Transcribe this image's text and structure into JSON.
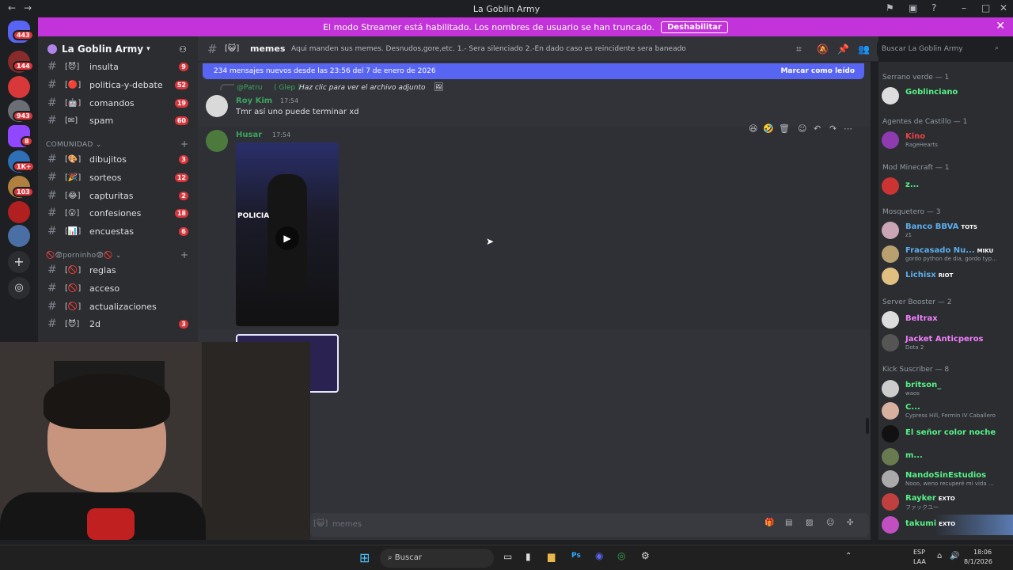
{
  "window": {
    "title": "La Goblin Army"
  },
  "banner": {
    "text": "El modo Streamer está habilitado. Los nombres de usuario se han truncado.",
    "button": "Deshabilitar"
  },
  "servers": {
    "badges": [
      "443",
      "144",
      "943",
      "8",
      "1K+",
      "103"
    ]
  },
  "guild": {
    "name": "La Goblin Army"
  },
  "channels": [
    {
      "name": "insulta",
      "badge": "9"
    },
    {
      "name": "politica-y-debate",
      "badge": "52"
    },
    {
      "name": "comandos",
      "badge": "19"
    },
    {
      "name": "spam",
      "badge": "60"
    }
  ],
  "category_comunidad": "COMUNIDAD",
  "channels2": [
    {
      "name": "dibujitos",
      "badge": "3"
    },
    {
      "name": "sorteos",
      "badge": "12"
    },
    {
      "name": "capturitas",
      "badge": "2"
    },
    {
      "name": "confesiones",
      "badge": "18"
    },
    {
      "name": "encuestas",
      "badge": "6"
    }
  ],
  "category_porninho": "porninho",
  "channels3": [
    {
      "name": "reglas",
      "badge": ""
    },
    {
      "name": "acceso",
      "badge": ""
    },
    {
      "name": "actualizaciones",
      "badge": ""
    },
    {
      "name": "2d",
      "badge": "3"
    }
  ],
  "channel_header": {
    "name": "memes",
    "topic": "Aqui manden sus memes. Desnudos,gore,etc. 1.- Sera silenciado 2.-En dado caso es reincidente sera baneado",
    "search_placeholder": "Buscar La Goblin Army"
  },
  "new_messages": {
    "text": "234 mensajes nuevos desde las 23:56 del 7 de enero de 2026",
    "mark": "Marcar como leído"
  },
  "messages": {
    "reply_user": "@Patru",
    "reply_tag": "( Glep )",
    "reply_text": "Haz clic para ver el archivo adjunto",
    "m1_user": "Roy Kim",
    "m1_time": "17:54",
    "m1_text": "Tmr así uno puede terminar xd",
    "m2_user": "Husar",
    "m2_time": "17:54"
  },
  "video_label": "POLICIA",
  "composer_placeholder": "memes",
  "members": {
    "cat1": "Serrano verde — 1",
    "m1": "Goblinciano",
    "cat2": "Agentes de Castillo — 1",
    "m2": "Kino",
    "m2s": "RageHearts",
    "cat3": "Mod Minecraft — 1",
    "m3": "z...",
    "cat4": "Mosquetero — 3",
    "m4": "Banco BBVA",
    "m4t": "TOTS",
    "m4s": "z1",
    "m5": "Fracasado Nu...",
    "m5t": "MIKU",
    "m5s": "gordo python de dia, gordo typ...",
    "m6": "Lichisx",
    "m6t": "RIOT",
    "cat5": "Server Booster — 2",
    "m7": "Beltrax",
    "m8": "Jacket Anticperos",
    "m8s": "Dota 2",
    "cat6": "Kick Suscriber — 8",
    "m9": "britson_",
    "m9s": "waos",
    "m10": "C...",
    "m10s": "Cypress Hill, Fermin IV Caballero",
    "m11": "El señor color noche",
    "m12": "m...",
    "m13": "NandoSinEstudios",
    "m13s": "Nooo, weno recuperé mi vida ...",
    "m14": "Rayker",
    "m14t": "EXTO",
    "m14s": "ファックユー",
    "m15": "takumi",
    "m15t": "EXTO"
  },
  "taskbar": {
    "search": "Buscar",
    "lang1": "ESP",
    "lang2": "LAA",
    "time": "18:06",
    "date": "8/1/2026"
  }
}
